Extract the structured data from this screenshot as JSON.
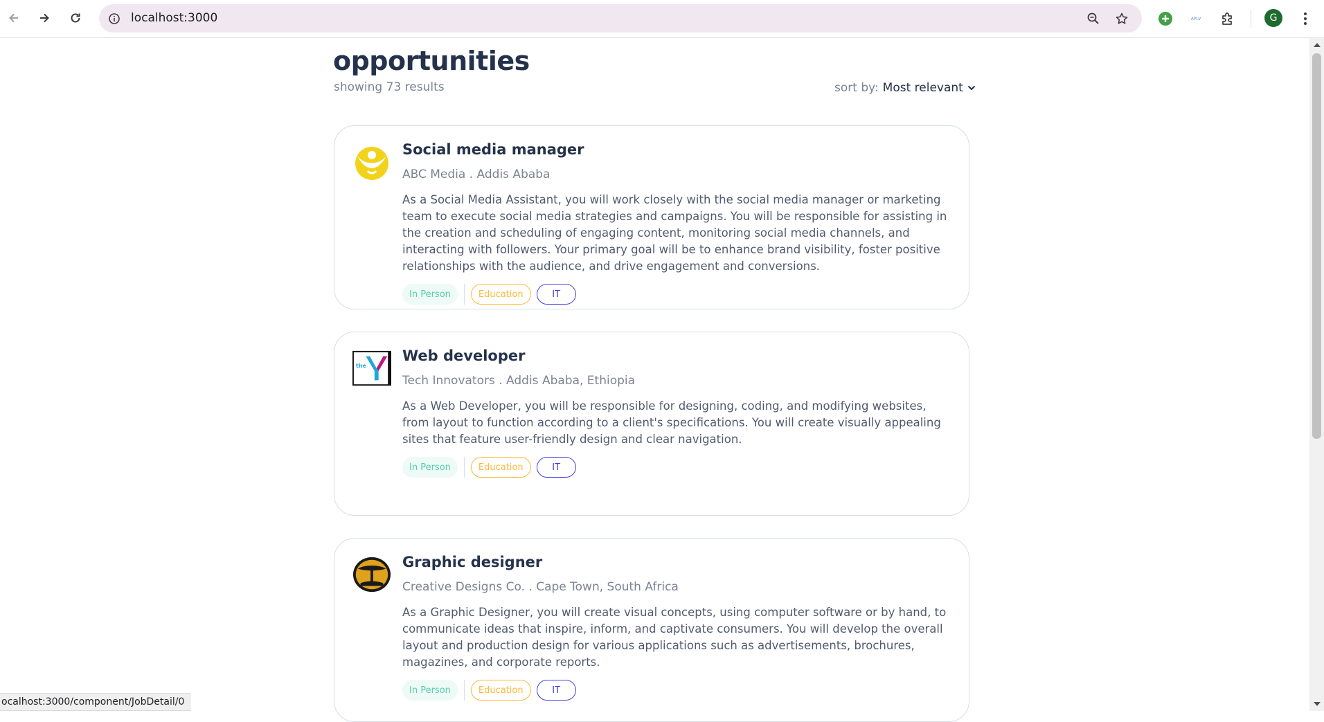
{
  "browser": {
    "url": "localhost:3000",
    "status_url": "ocalhost:3000/component/JobDetail/0",
    "profile_initial": "G",
    "extension_label": "APLV"
  },
  "page": {
    "title": "opportunities",
    "results_text": "showing 73 results",
    "sort_label": "sort by:",
    "sort_value": "Most relevant"
  },
  "jobs": [
    {
      "title": "Social media manager",
      "meta": "ABC Media . Addis Ababa",
      "description": "As a Social Media Assistant, you will work closely with the social media manager or marketing team to execute social media strategies and campaigns. You will be responsible for assisting in the creation and scheduling of engaging content, monitoring social media channels, and interacting with followers. Your primary goal will be to enhance brand visibility, foster positive relationships with the audience, and drive engagement and conversions.",
      "tags": [
        "In Person",
        "Education",
        "IT"
      ],
      "logo_text": ""
    },
    {
      "title": "Web developer",
      "meta": "Tech Innovators . Addis Ababa, Ethiopia",
      "description": "As a Web Developer, you will be responsible for designing, coding, and modifying websites, from layout to function according to a client's specifications. You will create visually appealing sites that feature user-friendly design and clear navigation.",
      "tags": [
        "In Person",
        "Education",
        "IT"
      ],
      "logo_text": "the"
    },
    {
      "title": "Graphic designer",
      "meta": "Creative Designs Co. . Cape Town, South Africa",
      "description": "As a Graphic Designer, you will create visual concepts, using computer software or by hand, to communicate ideas that inspire, inform, and captivate consumers. You will develop the overall layout and production design for various applications such as advertisements, brochures, magazines, and corporate reports.",
      "tags": [
        "In Person",
        "Education",
        "IT"
      ],
      "logo_text": ""
    }
  ],
  "colors": {
    "heading": "#25324b",
    "muted": "#7c8493",
    "tag_green": "#56cdad",
    "tag_orange": "#ffb836",
    "tag_blue": "#4640de",
    "omnibox": "#f1e7f1"
  },
  "icons": [
    "back-arrow-icon",
    "forward-arrow-icon",
    "reload-icon",
    "site-info-icon",
    "zoom-icon",
    "star-icon",
    "extension-plus-icon",
    "extensions-puzzle-icon",
    "menu-dots-icon",
    "chevron-down-icon"
  ]
}
